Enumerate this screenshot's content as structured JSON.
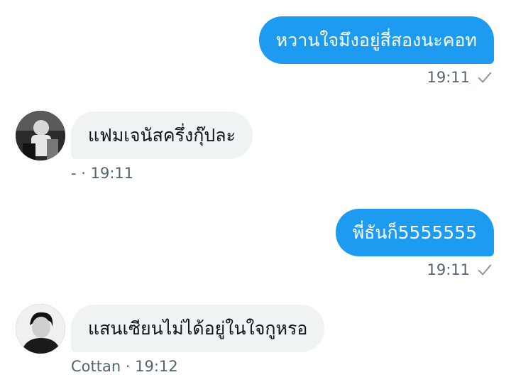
{
  "messages": [
    {
      "direction": "outgoing",
      "text": "หวานใจมึงอยู่สี่สองนะคอท",
      "time": "19:11",
      "status_icon": "check-icon"
    },
    {
      "direction": "incoming",
      "text": "แฟมเจนัสครึ่งกุ๊ปละ",
      "meta": "- · 19:11",
      "avatar_icon": "avatar-photo-1"
    },
    {
      "direction": "outgoing",
      "text": "พี่ธันก็5555555",
      "time": "19:11",
      "status_icon": "check-icon"
    },
    {
      "direction": "incoming",
      "text": "แสนเซียนไม่ได้อยู่ในใจกูหรอ",
      "meta": "Cottan · 19:12",
      "avatar_icon": "avatar-photo-2"
    }
  ],
  "colors": {
    "outgoing_bubble": "#1d9bf0",
    "incoming_bubble": "#eff3f4",
    "meta_text": "#536471",
    "check": "#8b98a5"
  }
}
